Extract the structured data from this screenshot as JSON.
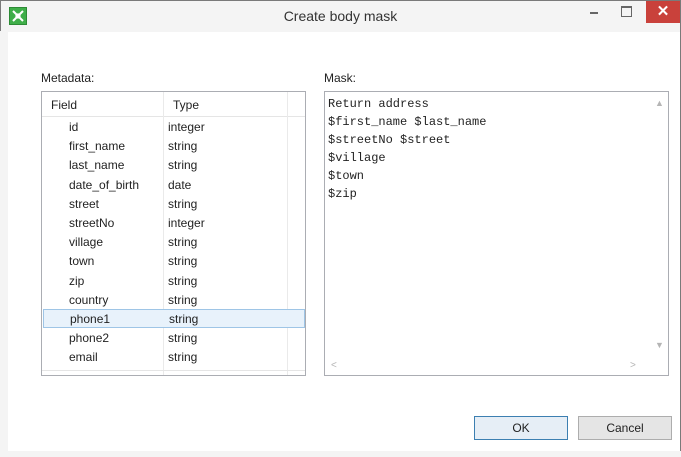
{
  "window": {
    "title": "Create body mask"
  },
  "metadata": {
    "label": "Metadata:",
    "columns": [
      "Field",
      "Type"
    ],
    "rows": [
      {
        "field": "id",
        "type": "integer"
      },
      {
        "field": "first_name",
        "type": "string"
      },
      {
        "field": "last_name",
        "type": "string"
      },
      {
        "field": "date_of_birth",
        "type": "date"
      },
      {
        "field": "street",
        "type": "string"
      },
      {
        "field": "streetNo",
        "type": "integer"
      },
      {
        "field": "village",
        "type": "string"
      },
      {
        "field": "town",
        "type": "string"
      },
      {
        "field": "zip",
        "type": "string"
      },
      {
        "field": "country",
        "type": "string"
      },
      {
        "field": "phone1",
        "type": "string"
      },
      {
        "field": "phone2",
        "type": "string"
      },
      {
        "field": "email",
        "type": "string"
      }
    ],
    "selected_field": "phone1"
  },
  "mask": {
    "label": "Mask:",
    "text": "Return address\n$first_name $last_name\n$streetNo $street\n$village\n$town\n$zip"
  },
  "buttons": {
    "ok": "OK",
    "cancel": "Cancel"
  },
  "icons": {
    "app": "app-icon",
    "minimize": "minimize-icon",
    "maximize": "maximize-icon",
    "close": "close-icon"
  }
}
